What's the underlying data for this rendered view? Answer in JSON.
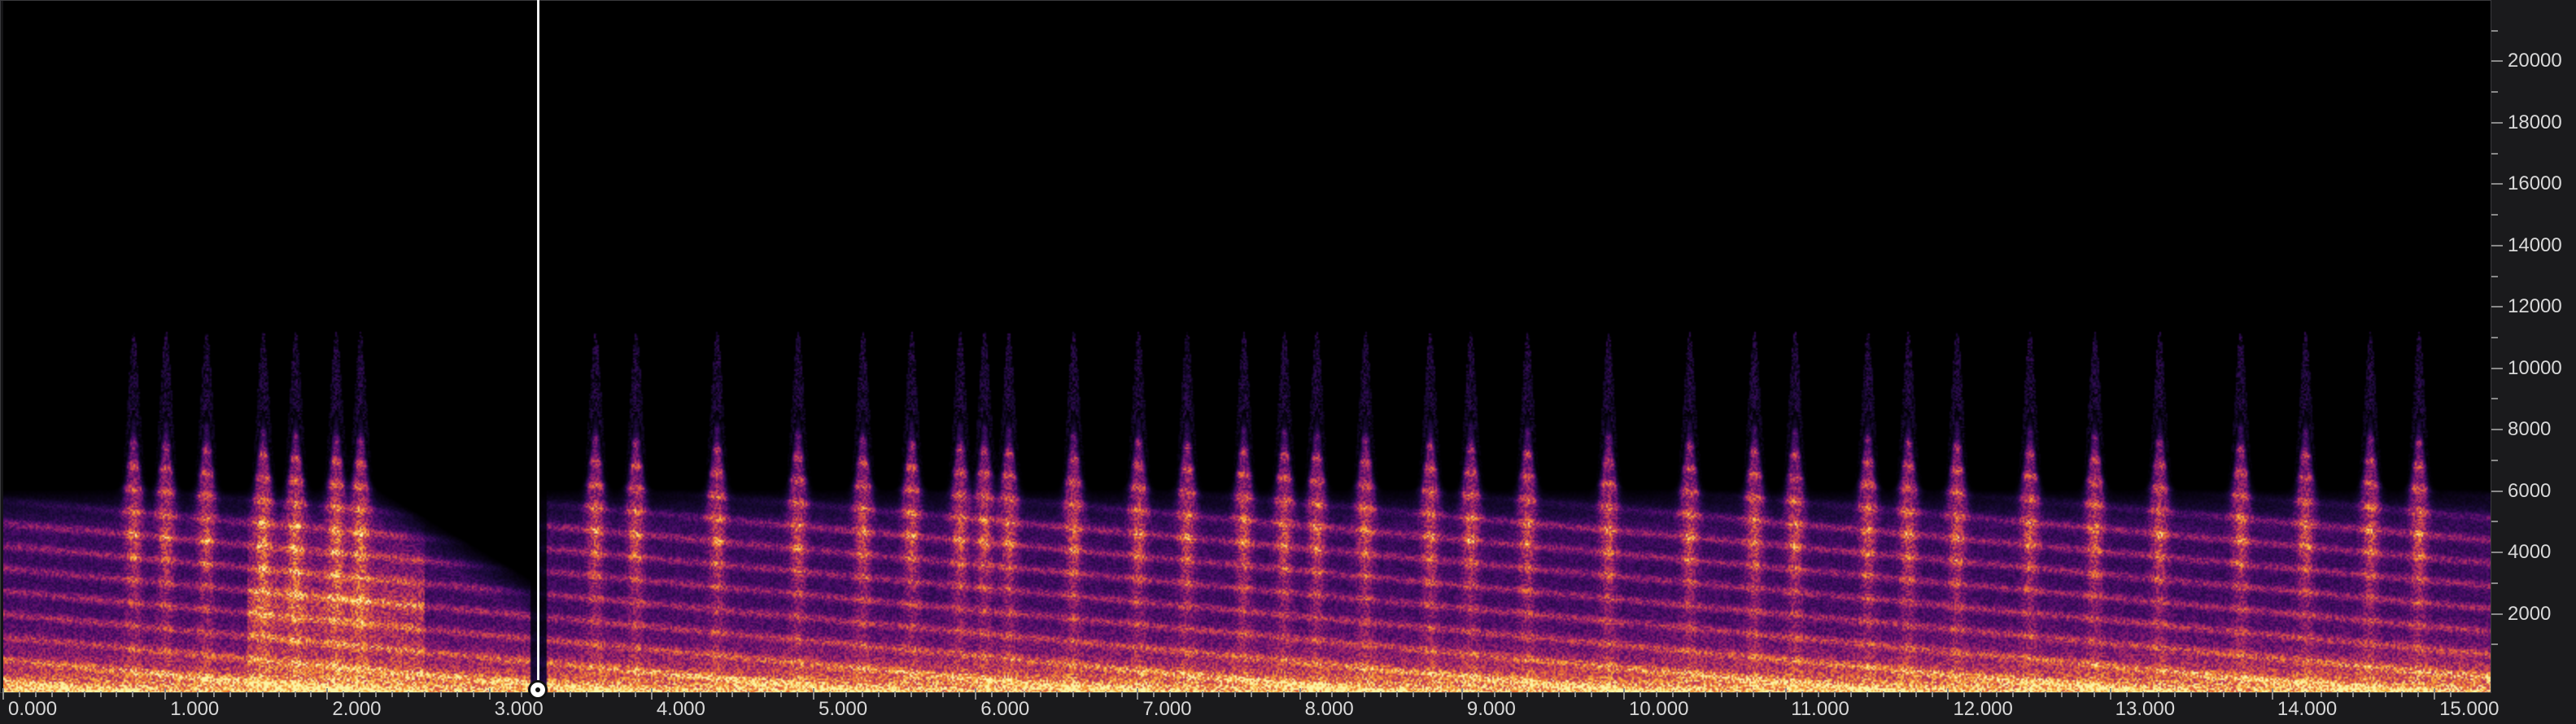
{
  "spectrogram": {
    "frequency_ticks": [
      {
        "value": 2000,
        "label": "2000"
      },
      {
        "value": 4000,
        "label": "4000"
      },
      {
        "value": 6000,
        "label": "6000"
      },
      {
        "value": 8000,
        "label": "8000"
      },
      {
        "value": 10000,
        "label": "10000"
      },
      {
        "value": 12000,
        "label": "12000"
      },
      {
        "value": 14000,
        "label": "14000"
      },
      {
        "value": 16000,
        "label": "16000"
      },
      {
        "value": 18000,
        "label": "18000"
      },
      {
        "value": 20000,
        "label": "20000"
      }
    ],
    "time_ticks": [
      {
        "value": 0,
        "label": "0.000"
      },
      {
        "value": 1,
        "label": "1.000"
      },
      {
        "value": 2,
        "label": "2.000"
      },
      {
        "value": 3,
        "label": "3.000"
      },
      {
        "value": 4,
        "label": "4.000"
      },
      {
        "value": 5,
        "label": "5.000"
      },
      {
        "value": 6,
        "label": "6.000"
      },
      {
        "value": 7,
        "label": "7.000"
      },
      {
        "value": 8,
        "label": "8.000"
      },
      {
        "value": 9,
        "label": "9.000"
      },
      {
        "value": 10,
        "label": "10.000"
      },
      {
        "value": 11,
        "label": "11.000"
      },
      {
        "value": 12,
        "label": "12.000"
      },
      {
        "value": 13,
        "label": "13.000"
      },
      {
        "value": 14,
        "label": "14.000"
      },
      {
        "value": 15,
        "label": "15.000"
      }
    ],
    "time_range": [
      0,
      15.1
    ],
    "frequency_range": [
      0,
      22000
    ],
    "playhead_time": 3.3,
    "colormap": [
      "#000000",
      "#1b0a3a",
      "#4a0c6b",
      "#8a1b6e",
      "#c23a5a",
      "#ea6a34",
      "#f9b23c",
      "#fcf4a3"
    ]
  }
}
